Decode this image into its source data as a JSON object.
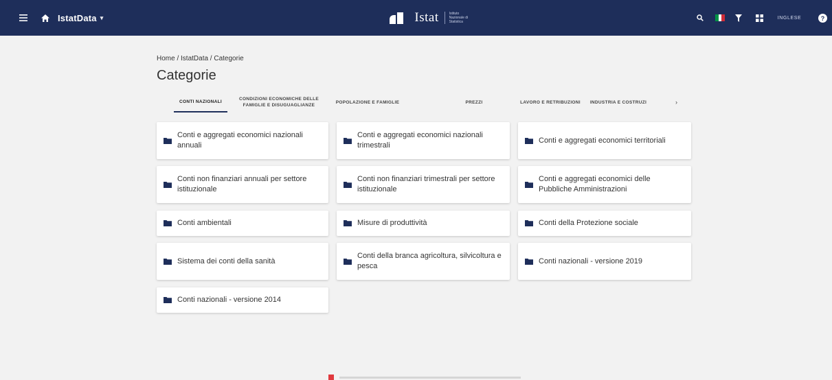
{
  "header": {
    "app_name": "IstatData",
    "app_caret": "▾",
    "logo_word": "Istat",
    "logo_sub": "Istituto Nazionale di Statistica",
    "lang_label": "INGLESE",
    "flag_colors": [
      "#009246",
      "#ffffff",
      "#ce2b37"
    ]
  },
  "breadcrumb": {
    "text": "Home / IstatData / Categorie"
  },
  "page": {
    "title": "Categorie"
  },
  "tabs": [
    {
      "label": "CONTI NAZIONALI",
      "active": true
    },
    {
      "label": "CONDIZIONI ECONOMICHE DELLE FAMIGLIE E DISUGUAGLIANZE",
      "active": false
    },
    {
      "label": "POPOLAZIONE E FAMIGLIE",
      "active": false
    },
    {
      "label": "PREZZI",
      "active": false
    },
    {
      "label": "LAVORO E RETRIBUZIONI",
      "active": false
    },
    {
      "label": "INDUSTRIA E COSTRUZI",
      "active": false
    }
  ],
  "tabs_next": "›",
  "categories": [
    "Conti e aggregati economici nazionali annuali",
    "Conti e aggregati economici nazionali trimestrali",
    "Conti e aggregati economici territoriali",
    "Conti non finanziari annuali per settore istituzionale",
    "Conti non finanziari trimestrali per settore istituzionale",
    "Conti e aggregati economici delle Pubbliche Amministrazioni",
    "Conti ambientali",
    "Misure di produttività",
    "Conti della Protezione sociale",
    "Sistema dei conti della sanità",
    "Conti della branca agricoltura, silvicoltura e pesca",
    "Conti nazionali - versione 2019",
    "Conti nazionali - versione 2014"
  ],
  "colors": {
    "topbar": "#1e2e5a",
    "folder": "#1e2e5a",
    "background": "#f2f2f2"
  }
}
